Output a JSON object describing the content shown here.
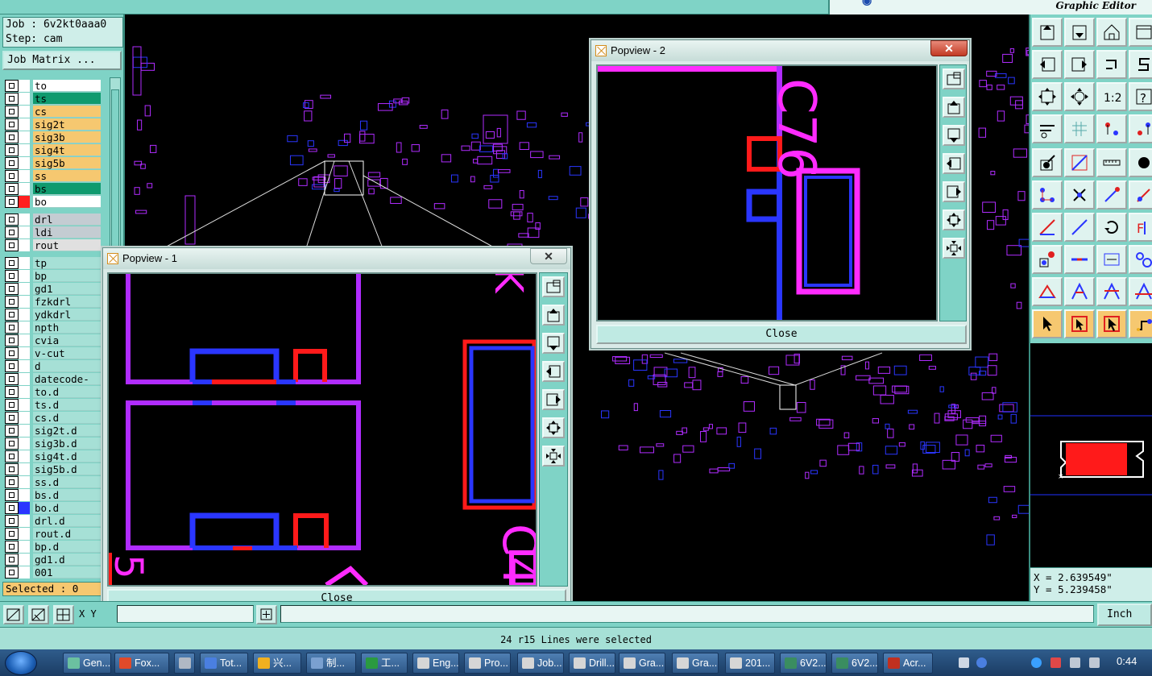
{
  "app": {
    "logo_title": "Graphic Editor",
    "job_label": "Job : 6v2kt0aaa0",
    "step_label": "Step: cam",
    "job_matrix_button": "Job Matrix ...",
    "selected_label": "Selected : 0"
  },
  "layers_group1": [
    {
      "name": "to",
      "color": "#ffffff",
      "swatch": "#ffffff"
    },
    {
      "name": "ts",
      "color": "#0f9a6e",
      "swatch": "#ffffff"
    },
    {
      "name": "cs",
      "color": "#f6c870",
      "swatch": "#ffffff"
    },
    {
      "name": "sig2t",
      "color": "#f6c870",
      "swatch": "#ffffff"
    },
    {
      "name": "sig3b",
      "color": "#f6c870",
      "swatch": "#ffffff"
    },
    {
      "name": "sig4t",
      "color": "#f6c870",
      "swatch": "#ffffff"
    },
    {
      "name": "sig5b",
      "color": "#f6c870",
      "swatch": "#ffffff"
    },
    {
      "name": "ss",
      "color": "#f6c870",
      "swatch": "#ffffff"
    },
    {
      "name": "bs",
      "color": "#0f9a6e",
      "swatch": "#ffffff"
    },
    {
      "name": "bo",
      "color": "#ffffff",
      "swatch": "#ff2020"
    }
  ],
  "layers_group2": [
    {
      "name": "drl",
      "color": "#c4ccd2",
      "swatch": "#ffffff"
    },
    {
      "name": "ldi",
      "color": "#c4ccd2",
      "swatch": "#ffffff"
    },
    {
      "name": "rout",
      "color": "#e0e0e0",
      "swatch": "#ffffff"
    }
  ],
  "layers_group3": [
    {
      "name": "tp",
      "color": "#a6e0d6",
      "swatch": "#ffffff"
    },
    {
      "name": "bp",
      "color": "#a6e0d6",
      "swatch": "#ffffff"
    },
    {
      "name": "gd1",
      "color": "#a6e0d6",
      "swatch": "#ffffff"
    },
    {
      "name": "fzkdrl",
      "color": "#a6e0d6",
      "swatch": "#ffffff"
    },
    {
      "name": "ydkdrl",
      "color": "#a6e0d6",
      "swatch": "#ffffff"
    },
    {
      "name": "npth",
      "color": "#a6e0d6",
      "swatch": "#ffffff"
    },
    {
      "name": "cvia",
      "color": "#a6e0d6",
      "swatch": "#ffffff"
    },
    {
      "name": "v-cut",
      "color": "#a6e0d6",
      "swatch": "#ffffff"
    },
    {
      "name": "d",
      "color": "#a6e0d6",
      "swatch": "#ffffff"
    },
    {
      "name": "datecode-to",
      "color": "#a6e0d6",
      "swatch": "#ffffff"
    },
    {
      "name": "to.d",
      "color": "#a6e0d6",
      "swatch": "#ffffff"
    },
    {
      "name": "ts.d",
      "color": "#a6e0d6",
      "swatch": "#ffffff"
    },
    {
      "name": "cs.d",
      "color": "#a6e0d6",
      "swatch": "#ffffff"
    },
    {
      "name": "sig2t.d",
      "color": "#a6e0d6",
      "swatch": "#ffffff"
    },
    {
      "name": "sig3b.d",
      "color": "#a6e0d6",
      "swatch": "#ffffff"
    },
    {
      "name": "sig4t.d",
      "color": "#a6e0d6",
      "swatch": "#ffffff"
    },
    {
      "name": "sig5b.d",
      "color": "#a6e0d6",
      "swatch": "#ffffff"
    },
    {
      "name": "ss.d",
      "color": "#a6e0d6",
      "swatch": "#ffffff"
    },
    {
      "name": "bs.d",
      "color": "#a6e0d6",
      "swatch": "#ffffff"
    },
    {
      "name": "bo.d",
      "color": "#a6e0d6",
      "swatch": "#2a36ff"
    },
    {
      "name": "drl.d",
      "color": "#a6e0d6",
      "swatch": "#ffffff"
    },
    {
      "name": "rout.d",
      "color": "#a6e0d6",
      "swatch": "#ffffff"
    },
    {
      "name": "bp.d",
      "color": "#a6e0d6",
      "swatch": "#ffffff"
    },
    {
      "name": "gd1.d",
      "color": "#a6e0d6",
      "swatch": "#ffffff"
    },
    {
      "name": "001",
      "color": "#a6e0d6",
      "swatch": "#ffffff"
    }
  ],
  "popview1": {
    "title": "Popview - 1",
    "close_button": "Close",
    "close_glyph": "✕"
  },
  "popview2": {
    "title": "Popview - 2",
    "close_button": "Close",
    "close_glyph": "✕"
  },
  "bottom": {
    "xy_label": "X Y",
    "unit_button": "Inch",
    "status_message": "24 r15 Lines were selected"
  },
  "coords": {
    "x": "X = 2.639549\"",
    "y": "Y = 5.239458\""
  },
  "taskbar": {
    "items": [
      "Gen...",
      "Fox...",
      "",
      "Tot...",
      "兴...",
      "制...",
      "工...",
      "Eng...",
      "Pro...",
      "Job...",
      "Drill...",
      "Gra...",
      "Gra...",
      "201...",
      "6V2...",
      "6V2...",
      "Acr..."
    ],
    "clock": "0:44"
  },
  "colors": {
    "panel": "#7fd3c6",
    "magenta": "#ff2bff",
    "purple_trace": "#b02cff",
    "blue_trace": "#2a36ff",
    "red_pad": "#ff1a1a"
  },
  "icons": {
    "window_close": "close-icon",
    "popview_window": "popview-window-icon"
  }
}
